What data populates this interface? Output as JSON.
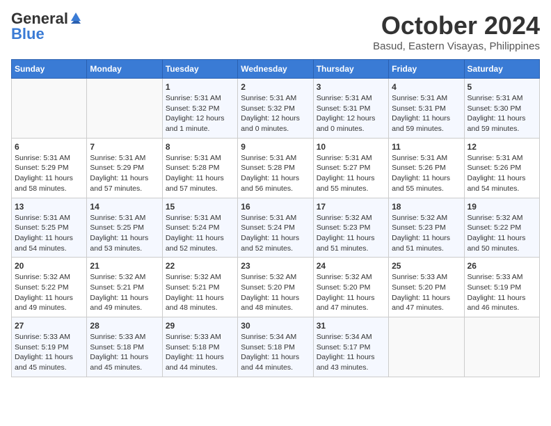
{
  "header": {
    "logo_general": "General",
    "logo_blue": "Blue",
    "month": "October 2024",
    "location": "Basud, Eastern Visayas, Philippines"
  },
  "weekdays": [
    "Sunday",
    "Monday",
    "Tuesday",
    "Wednesday",
    "Thursday",
    "Friday",
    "Saturday"
  ],
  "weeks": [
    [
      {
        "day": "",
        "info": ""
      },
      {
        "day": "",
        "info": ""
      },
      {
        "day": "1",
        "info": "Sunrise: 5:31 AM\nSunset: 5:32 PM\nDaylight: 12 hours and 1 minute."
      },
      {
        "day": "2",
        "info": "Sunrise: 5:31 AM\nSunset: 5:32 PM\nDaylight: 12 hours and 0 minutes."
      },
      {
        "day": "3",
        "info": "Sunrise: 5:31 AM\nSunset: 5:31 PM\nDaylight: 12 hours and 0 minutes."
      },
      {
        "day": "4",
        "info": "Sunrise: 5:31 AM\nSunset: 5:31 PM\nDaylight: 11 hours and 59 minutes."
      },
      {
        "day": "5",
        "info": "Sunrise: 5:31 AM\nSunset: 5:30 PM\nDaylight: 11 hours and 59 minutes."
      }
    ],
    [
      {
        "day": "6",
        "info": "Sunrise: 5:31 AM\nSunset: 5:29 PM\nDaylight: 11 hours and 58 minutes."
      },
      {
        "day": "7",
        "info": "Sunrise: 5:31 AM\nSunset: 5:29 PM\nDaylight: 11 hours and 57 minutes."
      },
      {
        "day": "8",
        "info": "Sunrise: 5:31 AM\nSunset: 5:28 PM\nDaylight: 11 hours and 57 minutes."
      },
      {
        "day": "9",
        "info": "Sunrise: 5:31 AM\nSunset: 5:28 PM\nDaylight: 11 hours and 56 minutes."
      },
      {
        "day": "10",
        "info": "Sunrise: 5:31 AM\nSunset: 5:27 PM\nDaylight: 11 hours and 55 minutes."
      },
      {
        "day": "11",
        "info": "Sunrise: 5:31 AM\nSunset: 5:26 PM\nDaylight: 11 hours and 55 minutes."
      },
      {
        "day": "12",
        "info": "Sunrise: 5:31 AM\nSunset: 5:26 PM\nDaylight: 11 hours and 54 minutes."
      }
    ],
    [
      {
        "day": "13",
        "info": "Sunrise: 5:31 AM\nSunset: 5:25 PM\nDaylight: 11 hours and 54 minutes."
      },
      {
        "day": "14",
        "info": "Sunrise: 5:31 AM\nSunset: 5:25 PM\nDaylight: 11 hours and 53 minutes."
      },
      {
        "day": "15",
        "info": "Sunrise: 5:31 AM\nSunset: 5:24 PM\nDaylight: 11 hours and 52 minutes."
      },
      {
        "day": "16",
        "info": "Sunrise: 5:31 AM\nSunset: 5:24 PM\nDaylight: 11 hours and 52 minutes."
      },
      {
        "day": "17",
        "info": "Sunrise: 5:32 AM\nSunset: 5:23 PM\nDaylight: 11 hours and 51 minutes."
      },
      {
        "day": "18",
        "info": "Sunrise: 5:32 AM\nSunset: 5:23 PM\nDaylight: 11 hours and 51 minutes."
      },
      {
        "day": "19",
        "info": "Sunrise: 5:32 AM\nSunset: 5:22 PM\nDaylight: 11 hours and 50 minutes."
      }
    ],
    [
      {
        "day": "20",
        "info": "Sunrise: 5:32 AM\nSunset: 5:22 PM\nDaylight: 11 hours and 49 minutes."
      },
      {
        "day": "21",
        "info": "Sunrise: 5:32 AM\nSunset: 5:21 PM\nDaylight: 11 hours and 49 minutes."
      },
      {
        "day": "22",
        "info": "Sunrise: 5:32 AM\nSunset: 5:21 PM\nDaylight: 11 hours and 48 minutes."
      },
      {
        "day": "23",
        "info": "Sunrise: 5:32 AM\nSunset: 5:20 PM\nDaylight: 11 hours and 48 minutes."
      },
      {
        "day": "24",
        "info": "Sunrise: 5:32 AM\nSunset: 5:20 PM\nDaylight: 11 hours and 47 minutes."
      },
      {
        "day": "25",
        "info": "Sunrise: 5:33 AM\nSunset: 5:20 PM\nDaylight: 11 hours and 47 minutes."
      },
      {
        "day": "26",
        "info": "Sunrise: 5:33 AM\nSunset: 5:19 PM\nDaylight: 11 hours and 46 minutes."
      }
    ],
    [
      {
        "day": "27",
        "info": "Sunrise: 5:33 AM\nSunset: 5:19 PM\nDaylight: 11 hours and 45 minutes."
      },
      {
        "day": "28",
        "info": "Sunrise: 5:33 AM\nSunset: 5:18 PM\nDaylight: 11 hours and 45 minutes."
      },
      {
        "day": "29",
        "info": "Sunrise: 5:33 AM\nSunset: 5:18 PM\nDaylight: 11 hours and 44 minutes."
      },
      {
        "day": "30",
        "info": "Sunrise: 5:34 AM\nSunset: 5:18 PM\nDaylight: 11 hours and 44 minutes."
      },
      {
        "day": "31",
        "info": "Sunrise: 5:34 AM\nSunset: 5:17 PM\nDaylight: 11 hours and 43 minutes."
      },
      {
        "day": "",
        "info": ""
      },
      {
        "day": "",
        "info": ""
      }
    ]
  ]
}
